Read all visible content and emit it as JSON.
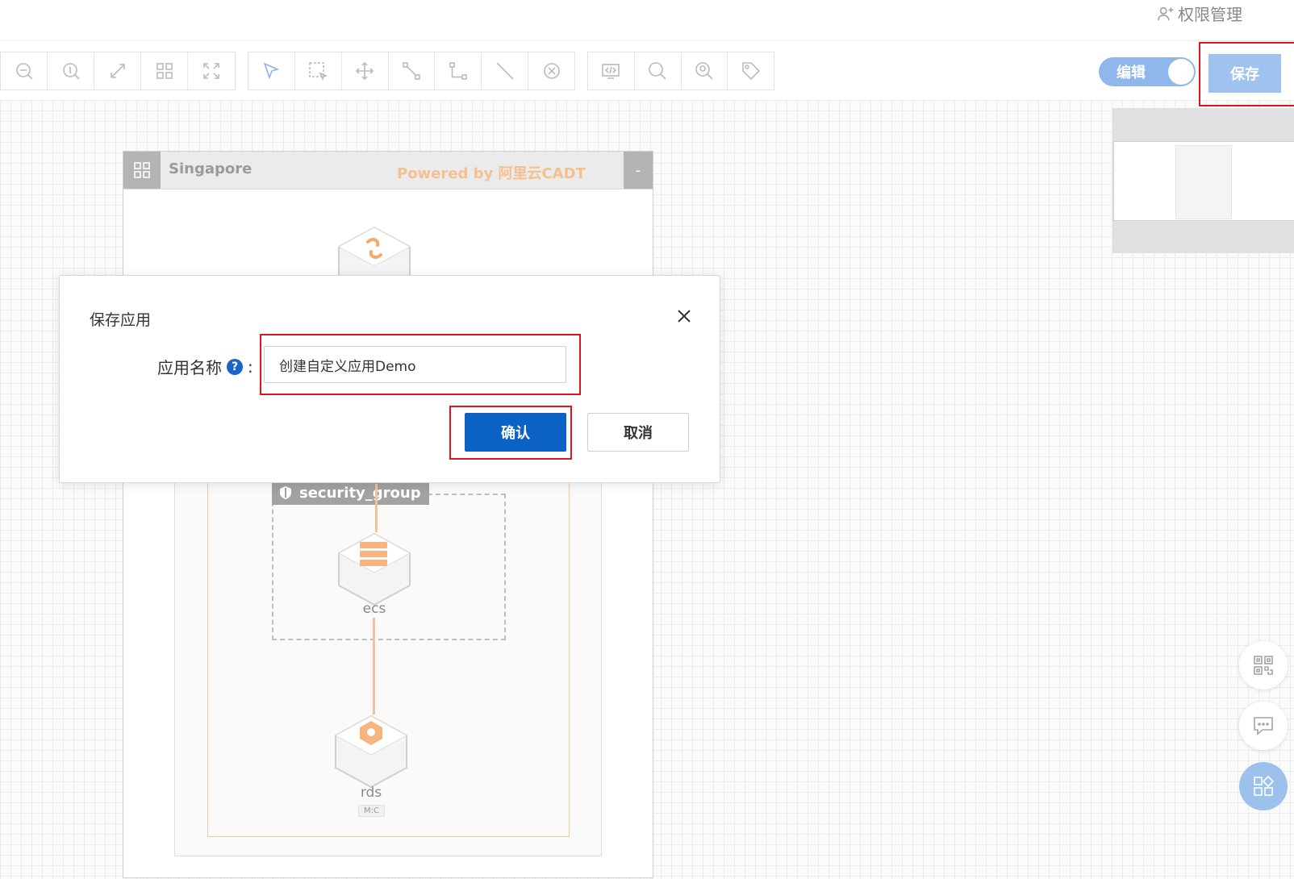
{
  "header": {
    "permission_label": "权限管理"
  },
  "toolbar": {
    "edit_toggle_label": "编辑",
    "save_label": "保存"
  },
  "diagram": {
    "region_name": "Singapore",
    "powered_by": "Powered by 阿里云CADT",
    "collapse_label": "-",
    "security_group_label": "security_group",
    "ecs_label": "ecs",
    "rds_label": "rds",
    "rds_tag": "M:C"
  },
  "dialog": {
    "title": "保存应用",
    "name_label": "应用名称",
    "help_icon": "?",
    "colon": ":",
    "name_value": "创建自定义应用Demo",
    "confirm_label": "确认",
    "cancel_label": "取消"
  },
  "icons": [
    "zoom-out-icon",
    "zoom-reset-icon",
    "fit-icon",
    "grid-icon",
    "fullscreen-icon",
    "pointer-icon",
    "marquee-icon",
    "move-icon",
    "connect-icon",
    "orth-line-icon",
    "line-icon",
    "delete-icon",
    "code-icon",
    "search-icon",
    "locate-icon",
    "tag-icon",
    "qrcode-icon",
    "chat-icon",
    "apps-icon"
  ],
  "colors": {
    "accent": "#0b62c4",
    "highlight": "#e0141b",
    "resource": "#f7b47f"
  }
}
